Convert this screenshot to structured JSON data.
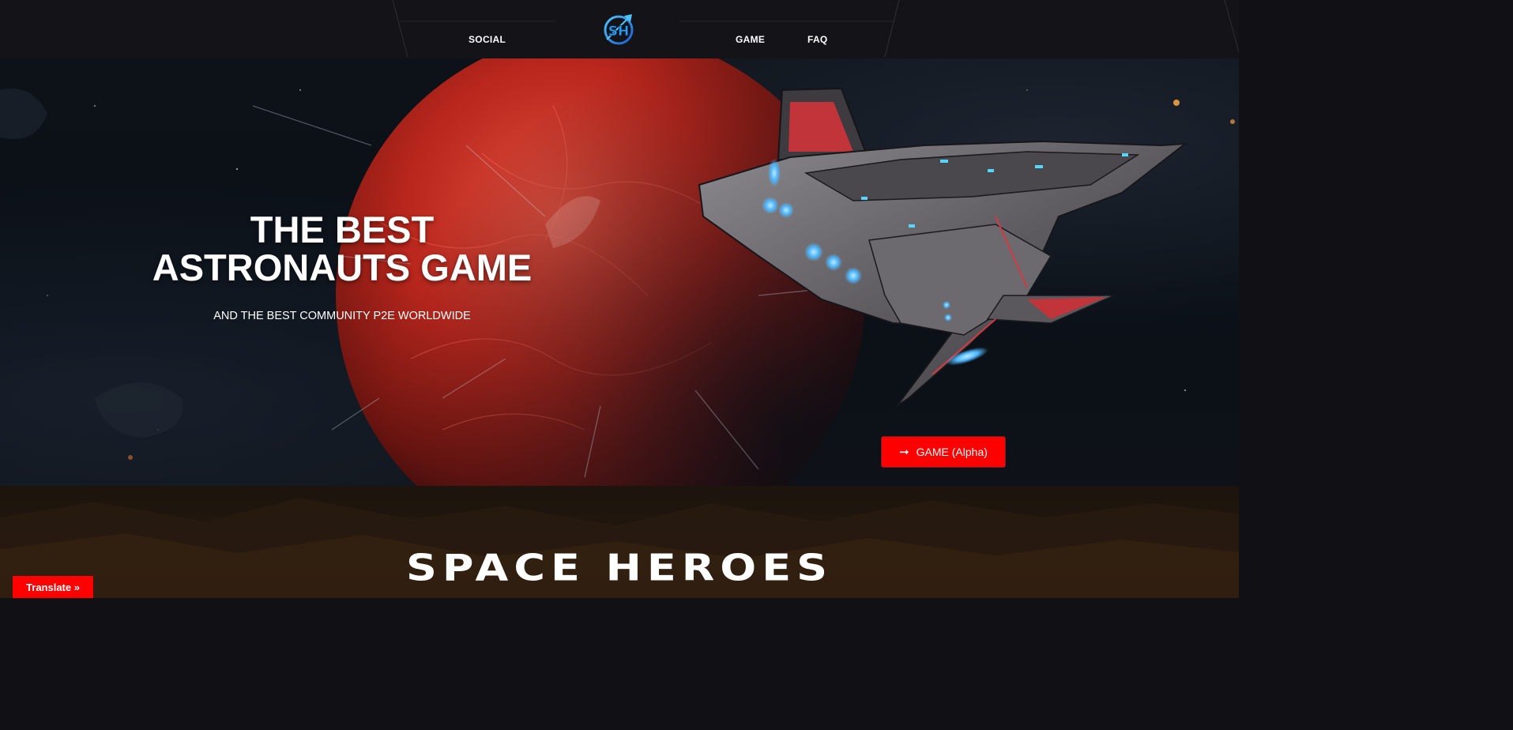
{
  "nav": {
    "links": [
      {
        "label": "SOCIAL"
      },
      {
        "label": "GAME"
      },
      {
        "label": "FAQ"
      }
    ],
    "logo_alt_text": "SH"
  },
  "hero": {
    "title_line1": "THE BEST",
    "title_line2": "ASTRONAUTS GAME",
    "subtitle": "AND THE BEST COMMUNITY P2E WORLDWIDE",
    "cta": {
      "label": "GAME (Alpha)",
      "icon": "arrow-right-icon"
    }
  },
  "section": {
    "title": "SPACE HEROES"
  },
  "translate_button": {
    "label": "Translate »"
  },
  "colors": {
    "nav_bg": "#141318",
    "accent_red": "#ff0000",
    "planet_red": "#c0231b",
    "logo_blue": "#1f8fe0",
    "section_brown": "#23170e"
  }
}
